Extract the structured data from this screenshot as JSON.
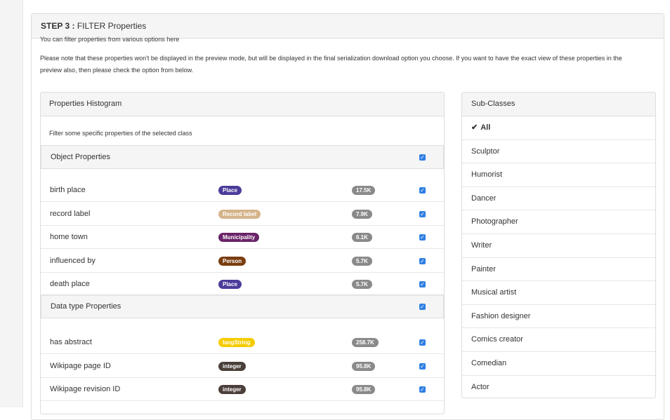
{
  "step": {
    "label": "STEP 3 :",
    "title": "FILTER Properties"
  },
  "intro": {
    "line1": "You can filter properties from various options here",
    "line2": "Please note that these properties won't be displayed in the preview mode, but will be displayed in the final serialization download option you choose. If you want to have the exact view of these properties in the preview also, then please check the option from below."
  },
  "histogram": {
    "title": "Properties Histogram",
    "subtitle": "Filter some specific properties of the selected class",
    "object_group": {
      "label": "Object Properties",
      "checked": true
    },
    "object_rows": [
      {
        "label": "birth place",
        "type": "Place",
        "type_color": "#4b3b9a",
        "count": "17.5K",
        "checked": true
      },
      {
        "label": "record label",
        "type": "Record label",
        "type_color": "#d5b48a",
        "count": "7.9K",
        "checked": true
      },
      {
        "label": "home town",
        "type": "Municipality",
        "type_color": "#6a2367",
        "count": "6.1K",
        "checked": true
      },
      {
        "label": "influenced by",
        "type": "Person",
        "type_color": "#7a3d10",
        "count": "5.7K",
        "checked": true
      },
      {
        "label": "death place",
        "type": "Place",
        "type_color": "#4b3b9a",
        "count": "5.7K",
        "checked": true
      }
    ],
    "datatype_group": {
      "label": "Data type Properties",
      "checked": true
    },
    "datatype_rows": [
      {
        "label": "has abstract",
        "type": "langString",
        "type_color": "#f5cc00",
        "count": "258.7K",
        "checked": true
      },
      {
        "label": "Wikipage page ID",
        "type": "integer",
        "type_color": "#4a3f39",
        "count": "95.8K",
        "checked": true
      },
      {
        "label": "Wikipage revision ID",
        "type": "integer",
        "type_color": "#4a3f39",
        "count": "95.8K",
        "checked": true
      }
    ]
  },
  "subclasses": {
    "title": "Sub-Classes",
    "items": [
      {
        "label": "All",
        "active": true
      },
      {
        "label": "Sculptor"
      },
      {
        "label": "Humorist"
      },
      {
        "label": "Dancer"
      },
      {
        "label": "Photographer"
      },
      {
        "label": "Writer"
      },
      {
        "label": "Painter"
      },
      {
        "label": "Musical artist"
      },
      {
        "label": "Fashion designer"
      },
      {
        "label": "Comics creator"
      },
      {
        "label": "Comedian"
      },
      {
        "label": "Actor"
      }
    ]
  }
}
